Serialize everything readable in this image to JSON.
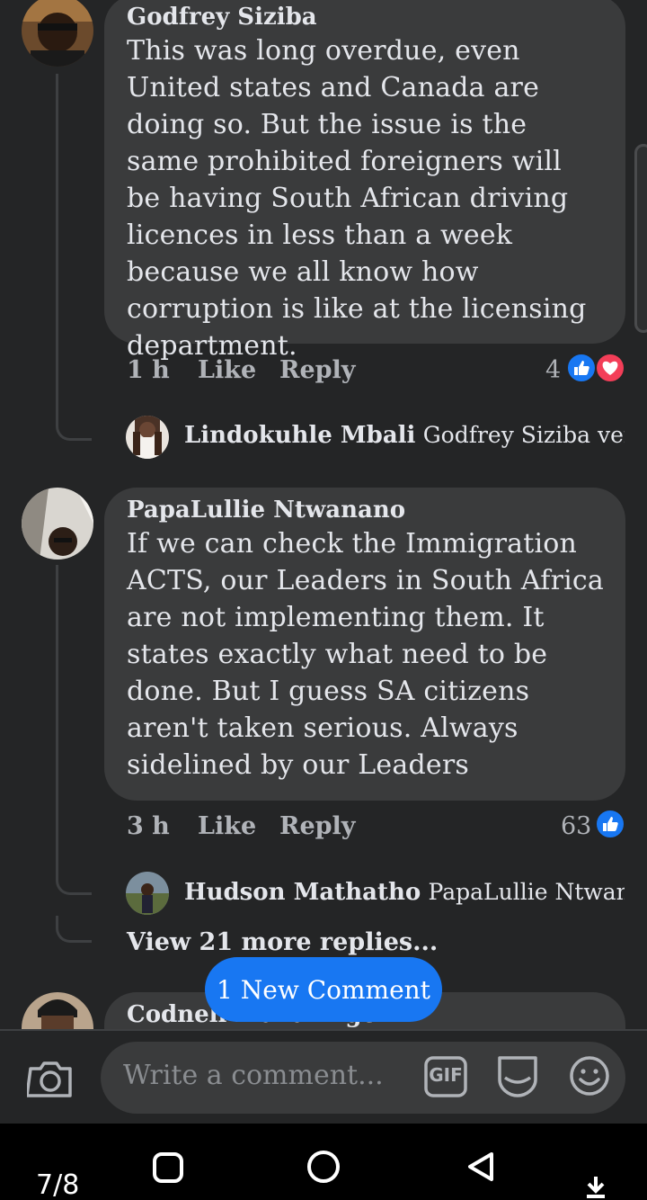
{
  "comments": [
    {
      "author": "Godfrey Siziba",
      "text": "This was long overdue, even United states and Canada are doing so. But the issue is the same prohibited foreigners will be having South African driving licences in less than a week because we all know how corruption is like at the licensing department.",
      "time": "1 h",
      "like": "Like",
      "reply": "Reply",
      "reaction_count": "4",
      "reactions": [
        "like-icon",
        "love-icon"
      ],
      "replies": [
        {
          "author": "Lindokuhle Mbali",
          "snippet": "Godfrey Siziba very tr..."
        }
      ]
    },
    {
      "author": "PapaLullie Ntwanano",
      "text": "If we can check the Immigration ACTS, our Leaders in South Africa are not implementing them. It states exactly what need to be done. But I guess SA citizens aren't taken serious. Always sidelined by our Leaders",
      "time": "3 h",
      "like": "Like",
      "reply": "Reply",
      "reaction_count": "63",
      "reactions": [
        "like-icon"
      ],
      "replies": [
        {
          "author": "Hudson Mathatho",
          "snippet": "PapaLullie Ntwanan..."
        }
      ],
      "view_more": "View 21 more replies..."
    },
    {
      "author": "Codnell Makaringe"
    }
  ],
  "new_comment_label": "1 New Comment",
  "composer": {
    "placeholder": "Write a comment...",
    "gif_label": "GIF"
  },
  "system": {
    "page_indicator": "7/8"
  },
  "colors": {
    "background": "#242526",
    "bubble": "#3a3b3c",
    "accent": "#1877f2",
    "love": "#f33e58",
    "muted": "#b0b3b8"
  }
}
